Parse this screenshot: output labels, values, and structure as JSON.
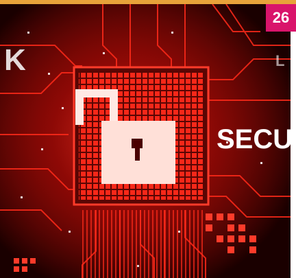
{
  "page_number": "26",
  "colors": {
    "accent_bar": "#e8a33a",
    "badge": "#d9146b",
    "circuit_red": "#ff2a1a",
    "background": "#2a0000"
  },
  "icons": [
    "unlocked-padlock-icon"
  ],
  "scene": {
    "word_left": "K",
    "word_right": "SECU",
    "letter_right_top": "L"
  }
}
